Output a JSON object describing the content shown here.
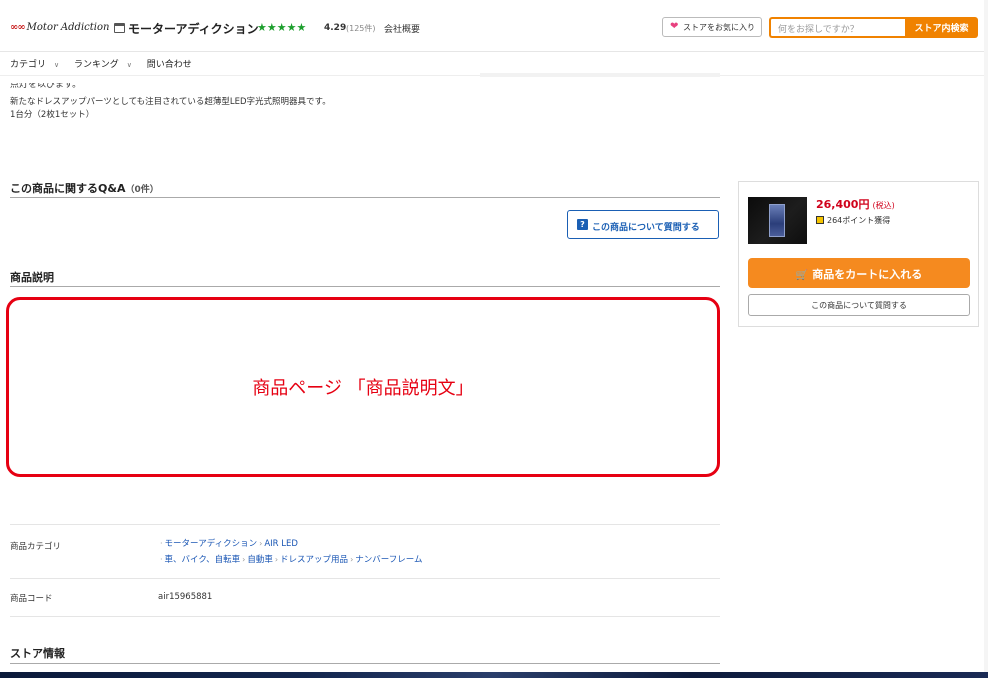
{
  "header": {
    "logo_mark": "∞∞",
    "logo_text": "Motor Addiction",
    "store_name": "モーターアディクション",
    "stars": "★★★★★",
    "rating": "4.29",
    "review_count": "(125件)",
    "company_link": "会社概要",
    "favorite_label": "ストアをお気に入り",
    "search_placeholder": "何をお探しですか？",
    "search_button": "ストア内検索"
  },
  "nav": {
    "items": [
      "カテゴリ",
      "ランキング",
      "問い合わせ"
    ]
  },
  "content": {
    "cut_text": "点灯を以びます。",
    "desc_line1": "新たなドレスアップパーツとしても注目されている超薄型LED字光式照明器具です。",
    "desc_line2": "1台分（2枚1セット）",
    "qa_title": "この商品に関するQ&A",
    "qa_count": "（0件）",
    "qa_button": "この商品について質問する",
    "qa_icon": "?",
    "desc_title": "商品説明",
    "placeholder_text": "商品ページ 「商品説明文」",
    "category_label": "商品カテゴリ",
    "category_path1": [
      "モーターアディクション",
      "AIR LED"
    ],
    "category_path2": [
      "車、バイク、自転車",
      "自動車",
      "ドレスアップ用品",
      "ナンバーフレーム"
    ],
    "code_label": "商品コード",
    "code_value": "air15965881",
    "store_info_title": "ストア情報"
  },
  "sidebar": {
    "price": "26,400円",
    "tax_label": "(税込)",
    "points": "264ポイント獲得",
    "cart_button": "商品をカートに入れる",
    "ask_button": "この商品について質問する"
  },
  "colors": {
    "brand_orange": "#f08200",
    "price_red": "#d0021b",
    "highlight_red": "#e60012",
    "link_blue": "#1a56b4",
    "rating_green": "#1c9e2d"
  }
}
